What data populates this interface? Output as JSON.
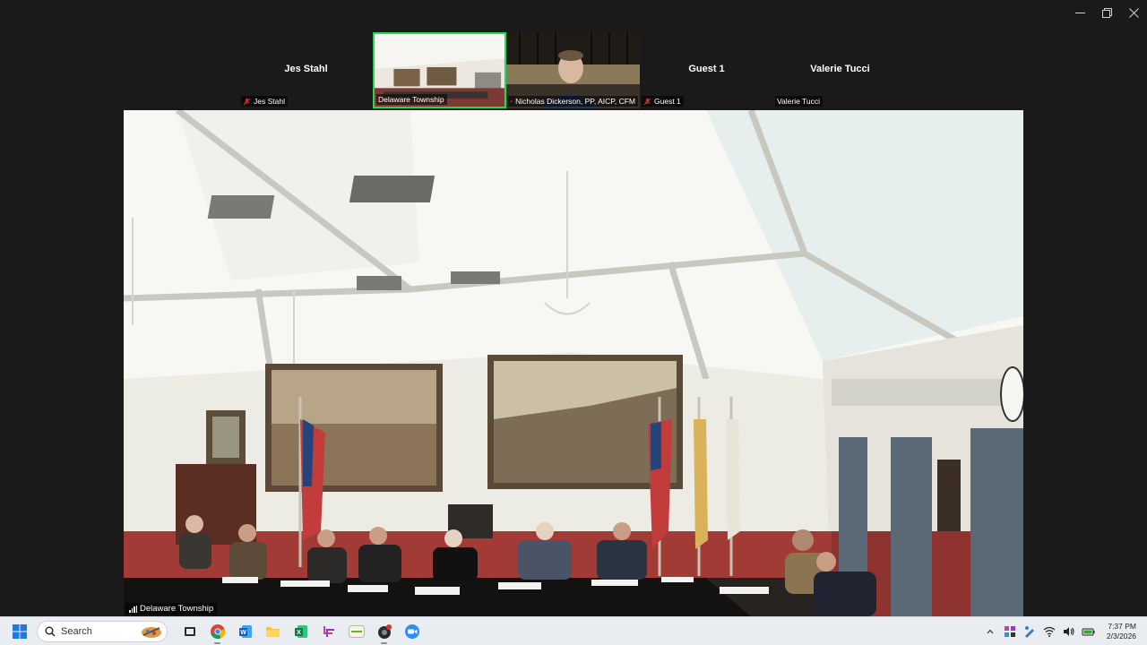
{
  "window": {
    "controls": [
      "minimize-icon",
      "restore-icon",
      "close-icon"
    ]
  },
  "participants": [
    {
      "name": "Jes Stahl",
      "label": "Jes Stahl",
      "video": false,
      "muted": true
    },
    {
      "name": "Delaware Township",
      "label": "Delaware Township",
      "video": true,
      "muted": false,
      "active_speaker": true
    },
    {
      "name": "Nicholas Dickerson, PP, AICP, CFM",
      "label": "Nicholas Dickerson, PP, AICP, CFM",
      "video": true,
      "muted": true
    },
    {
      "name": "Guest 1",
      "label": "Guest 1",
      "video": false,
      "muted": true
    },
    {
      "name": "Valerie Tucci",
      "label": "Valerie Tucci",
      "video": false,
      "muted": false
    }
  ],
  "main_video": {
    "label": "Delaware Township",
    "icon": "signal-bars-icon"
  },
  "taskbar": {
    "search_placeholder": "Search",
    "apps": [
      "file-explorer-icon",
      "chrome-icon",
      "word-icon",
      "folder-icon",
      "excel-icon",
      "snipping-tool-icon",
      "app-icon",
      "recorder-icon",
      "zoom-icon"
    ],
    "clock": {
      "time": "7:37 PM",
      "date": "2/3/2026"
    }
  },
  "colors": {
    "active_speaker_border": "#23d959",
    "mute_red": "#e02f2f",
    "zoom_blue": "#2d8cff"
  }
}
